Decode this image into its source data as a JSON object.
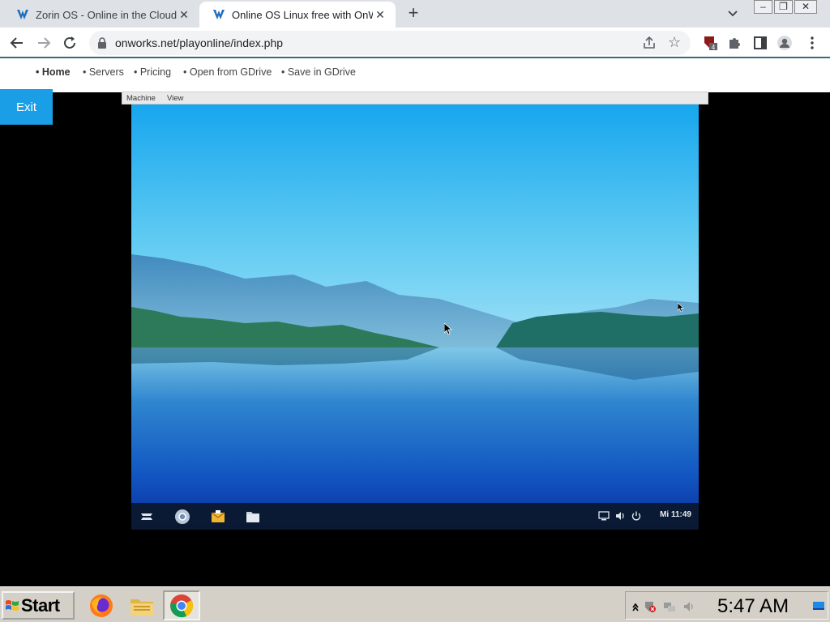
{
  "browser": {
    "tabs": [
      {
        "title": "Zorin OS - Online in the Cloud",
        "active": false
      },
      {
        "title": "Online OS Linux free with OnWorks",
        "active": true
      }
    ],
    "new_tab": "+",
    "close_glyph": "✕",
    "address": "onworks.net/playonline/index.php",
    "extension_badge": "4"
  },
  "site_nav": {
    "items": [
      "• Home",
      "• Servers",
      "• Pricing",
      "• Open from GDrive",
      "• Save in GDrive"
    ]
  },
  "exit_label": "Exit",
  "vm": {
    "menu": [
      "Machine",
      "View"
    ],
    "panel_clock": "Mi 11:49"
  },
  "taskbar": {
    "start_label": "Start",
    "time": "5:47 AM"
  },
  "colors": {
    "exit_bg": "#1a9fe6",
    "tab_strip": "#dee1e6",
    "toolbar_rule": "#3b6b76"
  }
}
